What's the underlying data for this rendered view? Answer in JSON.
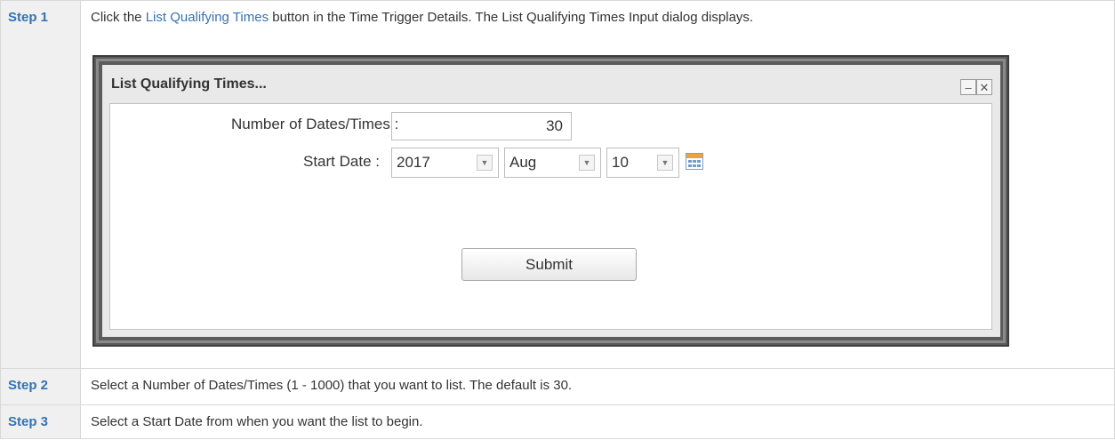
{
  "steps": [
    {
      "label": "Step 1",
      "text_before": "Click the ",
      "link": "List Qualifying Times",
      "text_after": " button in the Time Trigger Details. The List Qualifying Times Input dialog displays."
    },
    {
      "label": "Step 2",
      "text": "Select a Number of Dates/Times (1 - 1000) that you want to list. The default is 30."
    },
    {
      "label": "Step 3",
      "text": "Select a Start Date from when you want the list to begin."
    }
  ],
  "dialog": {
    "title": "List Qualifying Times...",
    "minimize_glyph": "–",
    "close_glyph": "✕",
    "number_label": "Number of Dates/Times :",
    "number_value": "30",
    "start_date_label": "Start Date :",
    "year": "2017",
    "month": "Aug",
    "day": "10",
    "arrow_glyph": "▼",
    "submit_label": "Submit",
    "icons": {
      "calendar": "calendar-icon",
      "minimize": "minimize-icon",
      "close": "close-icon"
    }
  }
}
